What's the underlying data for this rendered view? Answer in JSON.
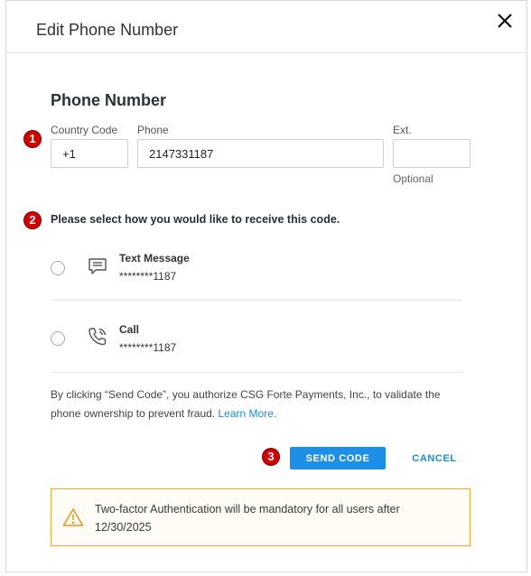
{
  "dialog": {
    "title": "Edit Phone Number",
    "close_icon": "close-icon"
  },
  "phone_section": {
    "title": "Phone Number",
    "country_code": {
      "label": "Country Code",
      "value": "+1"
    },
    "phone": {
      "label": "Phone",
      "value": "2147331187"
    },
    "ext": {
      "label": "Ext.",
      "value": "",
      "helper": "Optional"
    }
  },
  "markers": [
    "1",
    "2",
    "3"
  ],
  "delivery": {
    "question": "Please select how you would like to receive this code.",
    "options": [
      {
        "title": "Text Message",
        "masked": "********1187",
        "icon": "message-icon",
        "selected": false
      },
      {
        "title": "Call",
        "masked": "********1187",
        "icon": "phone-icon",
        "selected": false
      }
    ]
  },
  "disclaimer": {
    "text": "By clicking “Send Code”, you authorize CSG Forte Payments, Inc., to validate the phone ownership to prevent fraud.",
    "link": "Learn More."
  },
  "actions": {
    "send": "SEND CODE",
    "cancel": "CANCEL"
  },
  "warning": {
    "icon": "warning-icon",
    "text": "Two-factor Authentication will be mandatory for all users after 12/30/2025"
  },
  "colors": {
    "primary": "#1d8fe6",
    "link": "#1a8fd9",
    "warning_border": "#f0a830",
    "marker": "#d40000"
  }
}
